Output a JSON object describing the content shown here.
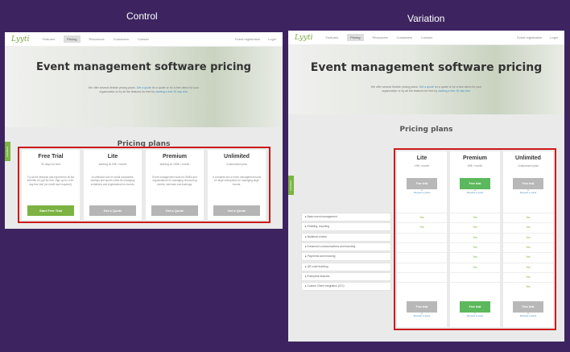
{
  "labels": {
    "control": "Control",
    "variation": "Variation"
  },
  "nav": {
    "logo": "Lyyti",
    "items": [
      "Features",
      "Pricing",
      "Resources",
      "Customers",
      "Contact"
    ],
    "right": [
      "Event registration",
      "Login"
    ]
  },
  "hero": {
    "title": "Event management software pricing",
    "line1_a": "We offer several flexible pricing plans.",
    "line1_link": "Get a quote",
    "line1_b": "for a quote or for a free demo for your",
    "line2_a": "organization or try all the features for free by",
    "line2_link": "starting a free 30 day trial."
  },
  "section_title": "Pricing plans",
  "feedback_tab": "Feedback",
  "control_plans": [
    {
      "name": "Free Trial",
      "price": "30 days for free",
      "desc": "Try all the features and experience all the benefits of Lyyti for free. Sign up for a 30-day free trial (no credit card required).",
      "button": "Start Free Trial",
      "color": "green"
    },
    {
      "name": "Lite",
      "price": "starting at 29€ / month",
      "desc": "An effective tool for small companies, startups and sports clubs for managing invitations and registrations for events.",
      "button": "Get a Quote",
      "color": "grey"
    },
    {
      "name": "Premium",
      "price": "starting at 169€ / month",
      "desc": "Event management tools for SMEs and organizations for managing reoccurring events, seminars and trainings.",
      "button": "Get a Quote",
      "color": "grey"
    },
    {
      "name": "Unlimited",
      "price": "Customized plan",
      "desc": "A complete set of event management tools for large enterprises for managing large events.",
      "button": "Get a Quote",
      "color": "grey"
    }
  ],
  "variation_plans": [
    {
      "name": "Lite",
      "price": "19€ / month",
      "button": "Free trial",
      "or": "or",
      "quote": "Request a quote",
      "color": "grey"
    },
    {
      "name": "Premium",
      "price": "69€ / month",
      "button": "Free trial",
      "or": "or",
      "quote": "Request a quote",
      "color": "green"
    },
    {
      "name": "Unlimited",
      "price": "Customized plan",
      "button": "Free trial",
      "or": "or",
      "quote": "Request a quote",
      "color": "grey"
    }
  ],
  "features": [
    {
      "label": "Basic event management",
      "yes": [
        true,
        true,
        true
      ]
    },
    {
      "label": "Emailing, reporting",
      "yes": [
        true,
        true,
        true
      ]
    },
    {
      "label": "Multilevel events",
      "yes": [
        false,
        true,
        true
      ]
    },
    {
      "label": "Enhanced communications and branding",
      "yes": [
        false,
        true,
        true
      ]
    },
    {
      "label": "Payments and invoicing",
      "yes": [
        false,
        true,
        true
      ]
    },
    {
      "label": "QR code ticketing",
      "yes": [
        false,
        true,
        true
      ]
    },
    {
      "label": "Enterprise features",
      "yes": [
        false,
        false,
        true
      ]
    },
    {
      "label": "Custom Client Integration (CCI)",
      "yes": [
        false,
        false,
        true
      ]
    }
  ],
  "yes_label": "Yes",
  "colors": {
    "background": "#3d2460",
    "highlight": "#cc1a1a",
    "green": "#7cb342"
  }
}
